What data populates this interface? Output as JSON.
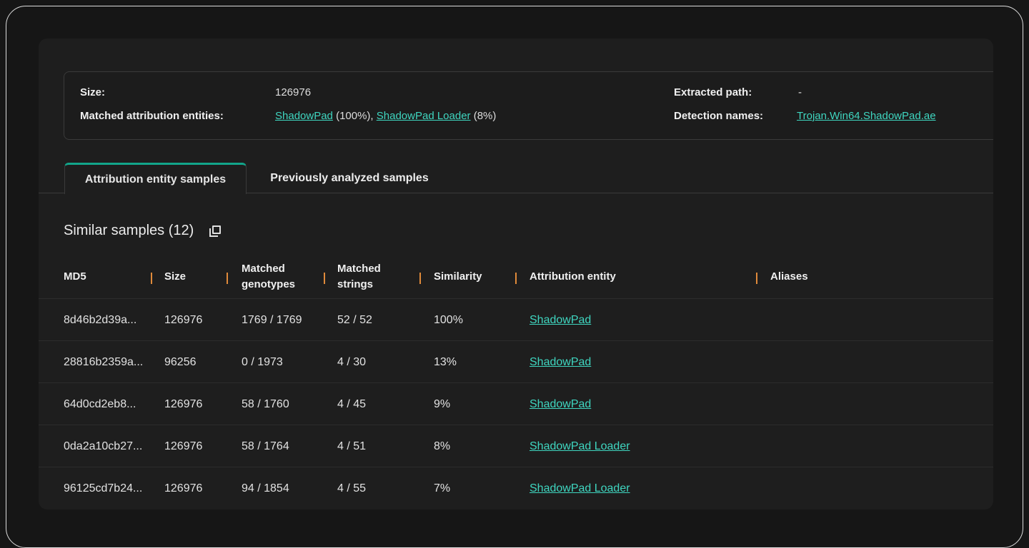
{
  "info": {
    "size_label": "Size:",
    "size_value": "126976",
    "matched_label": "Matched attribution entities:",
    "matched_entities": [
      {
        "name": "ShadowPad",
        "suffix": " (100%), "
      },
      {
        "name": "ShadowPad Loader",
        "suffix": " (8%)"
      }
    ],
    "extracted_label": "Extracted path:",
    "extracted_value": "-",
    "detection_label": "Detection names:",
    "detection_value": "Trojan.Win64.ShadowPad.ae"
  },
  "tabs": [
    {
      "label": "Attribution entity samples",
      "active": true
    },
    {
      "label": "Previously analyzed samples",
      "active": false
    }
  ],
  "section": {
    "title": "Similar samples (12)",
    "icon": "copy-icon"
  },
  "table": {
    "headers": {
      "md5": "MD5",
      "size": "Size",
      "genotypes_1": "Matched",
      "genotypes_2": "genotypes",
      "strings_1": "Matched",
      "strings_2": "strings",
      "similarity": "Similarity",
      "entity": "Attribution entity",
      "aliases": "Aliases"
    },
    "rows": [
      {
        "md5": "8d46b2d39a...",
        "size": "126976",
        "genotypes": "1769 / 1769",
        "strings": "52 / 52",
        "similarity": "100%",
        "entity": "ShadowPad",
        "aliases": ""
      },
      {
        "md5": "28816b2359a...",
        "size": "96256",
        "genotypes": "0 / 1973",
        "strings": "4 / 30",
        "similarity": "13%",
        "entity": "ShadowPad",
        "aliases": ""
      },
      {
        "md5": "64d0cd2eb8...",
        "size": "126976",
        "genotypes": "58 / 1760",
        "strings": "4 / 45",
        "similarity": "9%",
        "entity": "ShadowPad",
        "aliases": ""
      },
      {
        "md5": "0da2a10cb27...",
        "size": "126976",
        "genotypes": "58 / 1764",
        "strings": "4 / 51",
        "similarity": "8%",
        "entity": "ShadowPad Loader",
        "aliases": ""
      },
      {
        "md5": "96125cd7b24...",
        "size": "126976",
        "genotypes": "94 / 1854",
        "strings": "4 / 55",
        "similarity": "7%",
        "entity": "ShadowPad Loader",
        "aliases": ""
      }
    ]
  },
  "colors": {
    "accent": "#3fd6c0",
    "tab_active": "#12a58a",
    "separator": "#e08a3a"
  }
}
